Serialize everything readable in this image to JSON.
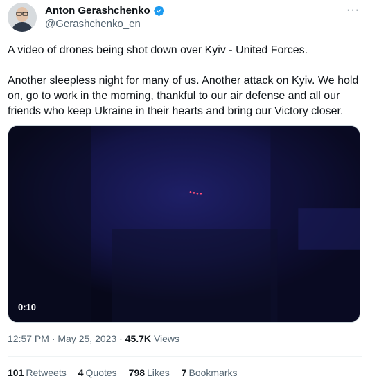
{
  "author": {
    "display_name": "Anton Gerashchenko",
    "handle": "@Gerashchenko_en",
    "verified_icon": "verified-badge-icon",
    "verified_color": "#1d9bf0"
  },
  "more_icon": "···",
  "tweet": {
    "paragraph1": "A video of drones being shot down over Kyiv - United Forces.",
    "paragraph2": "Another sleepless night for many of us. Another attack on Kyiv. We hold on, go to work in the morning, thankful to our air defense and all our friends who keep Ukraine in their hearts and bring our Victory closer."
  },
  "media": {
    "timecode": "0:10"
  },
  "meta": {
    "time": "12:57 PM",
    "separator": " · ",
    "date": "May 25, 2023",
    "views_count": "45.7K",
    "views_label": "Views"
  },
  "stats": {
    "retweets_count": "101",
    "retweets_label": "Retweets",
    "quotes_count": "4",
    "quotes_label": "Quotes",
    "likes_count": "798",
    "likes_label": "Likes",
    "bookmarks_count": "7",
    "bookmarks_label": "Bookmarks"
  }
}
